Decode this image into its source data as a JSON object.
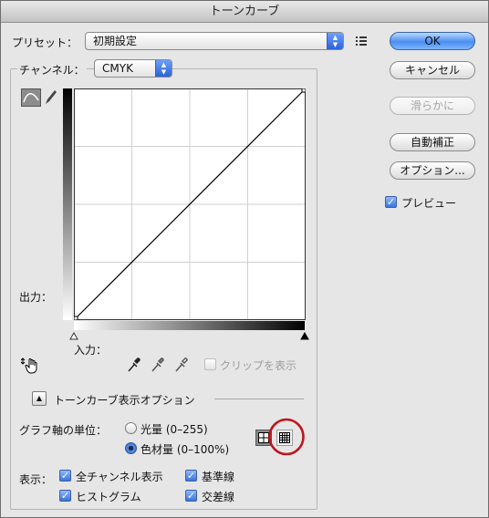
{
  "window": {
    "title": "トーンカーブ"
  },
  "preset": {
    "label": "プリセット：",
    "value": "初期設定",
    "menu_icon": "preset-options-icon"
  },
  "channel": {
    "label": "チャンネル：",
    "value": "CMYK"
  },
  "buttons": {
    "ok": "OK",
    "cancel": "キャンセル",
    "smooth": "滑らかに",
    "auto": "自動補正",
    "options": "オプション..."
  },
  "preview": {
    "label": "プレビュー",
    "checked": true
  },
  "graph": {
    "output_label": "出力：",
    "input_label": "入力：",
    "clip_label": "クリップを表示",
    "clip_checked": false,
    "curve_tool_icon": "curve-edit-icon",
    "pencil_tool_icon": "pencil-icon",
    "hand_icon": "on-image-adjust-icon",
    "eyedropper_icons": [
      "black-point-eyedropper-icon",
      "gray-point-eyedropper-icon",
      "white-point-eyedropper-icon"
    ]
  },
  "display_options": {
    "title": "トーンカーブ表示オプション",
    "axis_label": "グラフ軸の単位：",
    "radio_light": "光量 (0–255)",
    "radio_pigment": "色材量 (0–100%)",
    "selected_unit": "pigment",
    "grid_icons": [
      "simple-grid-icon",
      "detailed-grid-icon"
    ],
    "show_label": "表示：",
    "show_options": [
      {
        "label": "全チャンネル表示",
        "checked": true
      },
      {
        "label": "基準線",
        "checked": true
      },
      {
        "label": "ヒストグラム",
        "checked": true
      },
      {
        "label": "交差線",
        "checked": true
      }
    ]
  },
  "colors": {
    "accent": "#2a62d8",
    "highlight_circle": "#c0141c"
  }
}
